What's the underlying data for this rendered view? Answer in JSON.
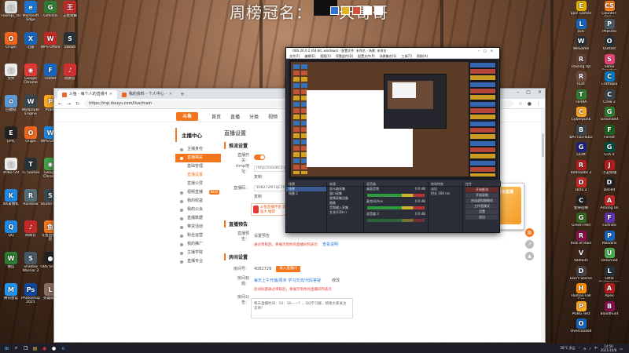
{
  "wallpaper": {
    "title": "周榜冠名：",
    "title_suffix": "天哥哥"
  },
  "desktop_left": [
    {
      "label": "Foxmpi_rar",
      "icon": "file-icon",
      "color": "#dddddd",
      "glyph": "▤"
    },
    {
      "label": "Origin",
      "icon": "origin-icon",
      "color": "#f0661f",
      "glyph": "O"
    },
    {
      "label": "文件",
      "icon": "file-icon",
      "color": "#ececec",
      "glyph": "▤"
    },
    {
      "label": "回收站",
      "icon": "recycle-bin-icon",
      "color": "#5b9bd5",
      "glyph": "♻"
    },
    {
      "label": "EPIC",
      "icon": "epic-icon",
      "color": "#222222",
      "glyph": "E"
    },
    {
      "label": "4082729",
      "icon": "file-icon",
      "color": "#ececec",
      "glyph": "▤"
    },
    {
      "label": "KK录像机",
      "icon": "kk-icon",
      "color": "#1e88e5",
      "glyph": "K"
    },
    {
      "label": "QQ",
      "icon": "qq-icon",
      "color": "#1e88e5",
      "glyph": "Q"
    },
    {
      "label": "微信",
      "icon": "wechat-icon",
      "color": "#2e7d32",
      "glyph": "W"
    },
    {
      "label": "腾讯会议",
      "icon": "meeting-icon",
      "color": "#2196f3",
      "glyph": "M"
    },
    {
      "label": "Microsoft Edge",
      "icon": "edge-icon",
      "color": "#1976d2",
      "glyph": "e"
    },
    {
      "label": "迅雷",
      "icon": "xunlei-icon",
      "color": "#1565c0",
      "glyph": "X"
    },
    {
      "label": "Google Chrome",
      "icon": "chrome-icon",
      "color": "#e53935",
      "glyph": "◉"
    },
    {
      "label": "Wallpaper Engine",
      "icon": "wallpaper-icon",
      "color": "#37474f",
      "glyph": "W"
    },
    {
      "label": "Origin",
      "icon": "origin-icon",
      "color": "#f0661f",
      "glyph": "O"
    },
    {
      "label": "TC Games",
      "icon": "tcgames-icon",
      "color": "#263238",
      "glyph": "T"
    },
    {
      "label": "Rainbow",
      "icon": "rainbow-icon",
      "color": "#546e7a",
      "glyph": "R"
    },
    {
      "label": "网易云",
      "icon": "music-icon",
      "color": "#c62828",
      "glyph": "♪"
    },
    {
      "label": "Shadow Warrior 2",
      "icon": "game-icon",
      "color": "#455a64",
      "glyph": "S"
    },
    {
      "label": "Photoshop 2021",
      "icon": "photoshop-icon",
      "color": "#0d47a1",
      "glyph": "Ps"
    },
    {
      "label": "Geforce",
      "icon": "geforce-icon",
      "color": "#2e7d32",
      "glyph": "G"
    },
    {
      "label": "WPS Office",
      "icon": "wps-icon",
      "color": "#c62828",
      "glyph": "W"
    },
    {
      "label": "Fiddler",
      "icon": "fiddler-icon",
      "color": "#1565c0",
      "glyph": "F"
    },
    {
      "label": "PUBG",
      "icon": "pubg-icon",
      "color": "#f9a825",
      "glyph": "P"
    },
    {
      "label": "WPS Office",
      "icon": "wps-icon",
      "color": "#1e88e5",
      "glyph": "W"
    },
    {
      "label": "Google Chrome",
      "icon": "chrome-icon",
      "color": "#43a047",
      "glyph": "◉"
    },
    {
      "label": "Studio One",
      "icon": "studio-icon",
      "color": "#37474f",
      "glyph": "S"
    },
    {
      "label": "斗鱼直播伴侣",
      "icon": "douyu-icon",
      "color": "#f5751d",
      "glyph": "鱼"
    },
    {
      "label": "OBS Studio",
      "icon": "obs-icon",
      "color": "#212121",
      "glyph": "●"
    },
    {
      "label": "英雄联盟",
      "icon": "lol-icon",
      "color": "#8d6e63",
      "glyph": "L"
    },
    {
      "label": "王者荣耀",
      "icon": "game-icon",
      "color": "#c62828",
      "glyph": "王"
    },
    {
      "label": "Steam",
      "icon": "steam-icon",
      "color": "#263238",
      "glyph": "S"
    },
    {
      "label": "网易云",
      "icon": "music-icon",
      "color": "#d32f2f",
      "glyph": "♪"
    },
    {
      "label": "鸿蒙",
      "icon": "app-icon",
      "color": "#455a64",
      "glyph": "H"
    },
    {
      "label": "Zoom",
      "icon": "zoom-icon",
      "color": "#1565c0",
      "glyph": "Z"
    },
    {
      "label": "腾讯QQ",
      "icon": "qq-icon",
      "color": "#1976d2",
      "glyph": "Q"
    },
    {
      "label": "Deezer",
      "icon": "app-icon",
      "color": "#9c27b0",
      "glyph": "D"
    },
    {
      "label": "Bandicam",
      "icon": "bandicam-icon",
      "color": "#212121",
      "glyph": "B"
    },
    {
      "label": "Welcome",
      "icon": "welcome-icon",
      "color": "#d84315",
      "glyph": "W"
    },
    {
      "label": "火绒安全",
      "icon": "security-icon",
      "color": "#ef6c00",
      "glyph": "火"
    }
  ],
  "desktop_right": [
    {
      "label": "Epic Games",
      "icon": "epic-icon",
      "color": "#e0b100",
      "glyph": "E"
    },
    {
      "label": "LOL",
      "icon": "lol-icon",
      "color": "#1565c0",
      "glyph": "L"
    },
    {
      "label": "WeGame",
      "icon": "wegame-icon",
      "color": "#263238",
      "glyph": "W"
    },
    {
      "label": "Raising Up",
      "icon": "game-icon",
      "color": "#5d4037",
      "glyph": "R"
    },
    {
      "label": "Rust",
      "icon": "rust-icon",
      "color": "#6d4c41",
      "glyph": "R"
    },
    {
      "label": "TERRA",
      "icon": "game-icon",
      "color": "#2e7d32",
      "glyph": "T"
    },
    {
      "label": "Cyberpunk",
      "icon": "game-icon",
      "color": "#f9a825",
      "glyph": "C"
    },
    {
      "label": "BATTLEFIELD",
      "icon": "game-icon",
      "color": "#37474f",
      "glyph": "B"
    },
    {
      "label": "GLIM",
      "icon": "game-icon",
      "color": "#1a237e",
      "glyph": "G"
    },
    {
      "label": "Rednoobs 2",
      "icon": "game-icon",
      "color": "#b71c1c",
      "glyph": "R"
    },
    {
      "label": "Dota 2",
      "icon": "dota-icon",
      "color": "#c62828",
      "glyph": "D"
    },
    {
      "label": "使命召唤",
      "icon": "game-icon",
      "color": "#212121",
      "glyph": "C"
    },
    {
      "label": "Green Hell",
      "icon": "game-icon",
      "color": "#33691e",
      "glyph": "G"
    },
    {
      "label": "Risk of Rain",
      "icon": "game-icon",
      "color": "#880e4f",
      "glyph": "R"
    },
    {
      "label": "Valheim",
      "icon": "game-icon",
      "color": "#3e2723",
      "glyph": "V"
    },
    {
      "label": "Don't Starve",
      "icon": "game-icon",
      "color": "#424242",
      "glyph": "D"
    },
    {
      "label": "Human Fall Flat",
      "icon": "game-icon",
      "color": "#ff8f00",
      "glyph": "H"
    },
    {
      "label": "PUBG Test",
      "icon": "pubg-icon",
      "color": "#f9a825",
      "glyph": "P"
    },
    {
      "label": "Overcooked",
      "icon": "game-icon",
      "color": "#1565c0",
      "glyph": "O"
    },
    {
      "label": "Counter-Strike",
      "icon": "csgo-icon",
      "color": "#f57f17",
      "glyph": "CS"
    },
    {
      "label": "Phasmo",
      "icon": "game-icon",
      "color": "#455a64",
      "glyph": "P"
    },
    {
      "label": "Outlast",
      "icon": "game-icon",
      "color": "#263238",
      "glyph": "O"
    },
    {
      "label": "Slime Rancher",
      "icon": "game-icon",
      "color": "#ec407a",
      "glyph": "S"
    },
    {
      "label": "Craftopia",
      "icon": "game-icon",
      "color": "#0277bd",
      "glyph": "C"
    },
    {
      "label": "Crew 2",
      "icon": "game-icon",
      "color": "#37474f",
      "glyph": "C"
    },
    {
      "label": "Grounded",
      "icon": "game-icon",
      "color": "#2e7d32",
      "glyph": "G"
    },
    {
      "label": "Forest",
      "icon": "game-icon",
      "color": "#1b5e20",
      "glyph": "F"
    },
    {
      "label": "GTA V",
      "icon": "game-icon",
      "color": "#004d40",
      "glyph": "G"
    },
    {
      "label": "小丑惊魂",
      "icon": "game-icon",
      "color": "#b71c1c",
      "glyph": "J"
    },
    {
      "label": "Deceit",
      "icon": "game-icon",
      "color": "#212121",
      "glyph": "D"
    },
    {
      "label": "Among Us",
      "icon": "game-icon",
      "color": "#c62828",
      "glyph": "A"
    },
    {
      "label": "Fortnite",
      "icon": "game-icon",
      "color": "#5e35b1",
      "glyph": "F"
    },
    {
      "label": "Paladins",
      "icon": "game-icon",
      "color": "#1565c0",
      "glyph": "P"
    },
    {
      "label": "Unturned",
      "icon": "game-icon",
      "color": "#4caf50",
      "glyph": "U"
    },
    {
      "label": "Little Nightmares",
      "icon": "game-icon",
      "color": "#263238",
      "glyph": "L"
    },
    {
      "label": "Apex",
      "icon": "game-icon",
      "color": "#b71c1c",
      "glyph": "A"
    },
    {
      "label": "Bloodhunt",
      "icon": "game-icon",
      "color": "#880e4f",
      "glyph": "B"
    }
  ],
  "browser": {
    "tabs": [
      {
        "label": "斗鱼 - 每个人的直播平台"
      },
      {
        "label": "我的资料 - 个人中心 - 斗鱼"
      }
    ],
    "url": "https://mp.douyu.com/live/main",
    "site": {
      "logo": "斗鱼",
      "nav": [
        "首页",
        "直播",
        "分类",
        "视频"
      ]
    },
    "sidebar": {
      "header": "主播中心",
      "items": [
        {
          "label": "主播身份",
          "active": false,
          "sub": false
        },
        {
          "label": "直播相关",
          "active": true,
          "sub": false
        },
        {
          "label": "基础管理",
          "active": false,
          "sub": true
        },
        {
          "label": "直播设置",
          "active": true,
          "sub": true
        },
        {
          "label": "直播公屏",
          "active": false,
          "sub": true
        },
        {
          "label": "视频直播",
          "active": false,
          "sub": false,
          "tag": "NEW"
        },
        {
          "label": "我的收益",
          "active": false,
          "sub": false
        },
        {
          "label": "我的公会",
          "active": false,
          "sub": false
        },
        {
          "label": "直播数据",
          "active": false,
          "sub": false
        },
        {
          "label": "带货活动",
          "active": false,
          "sub": false
        },
        {
          "label": "粉丝运营",
          "active": false,
          "sub": false
        },
        {
          "label": "我的推广",
          "active": false,
          "sub": false
        },
        {
          "label": "主播学院",
          "active": false,
          "sub": false
        },
        {
          "label": "直播专业",
          "active": false,
          "sub": false
        }
      ]
    },
    "main": {
      "title": "直播设置",
      "push_section": "推流设置",
      "push_switch_label": "直播开关：",
      "rtmp_label": "rtmp地址：",
      "rtmp_value": "rtmp://sendtc3.douyu.com/live",
      "copy1": "复制",
      "key_label": "直播码：",
      "key_value": "4082729r1qC7P99N",
      "copy2": "复制",
      "promo": "斗鱼直播伴侣 功能强大 推荐",
      "preview_section": "直播预告",
      "preview_label": "直播预告：",
      "preview_btn": "设置预告",
      "preview_note": "通过审核后，将展示到你的直播间列表页",
      "preview_link": "查看说明",
      "room_section": "房间设置",
      "room_no_label": "房间号：",
      "room_no": "4082729",
      "room_btn": "进入直播间",
      "room_title_label": "房间标题：",
      "room_title": "每天上午开播/周末 学习交流/代码答疑",
      "modify": "修改",
      "room_note": "房间标题通过审核后，将展示到你的直播间列表页",
      "notice_label": "房间公告：",
      "notice_text": "每天直播时间：10：30——？，QQ学习群，感谢大家关注支持！"
    },
    "side_ad": "斗鱼直播伴侣"
  },
  "obs": {
    "title": "OBS 26.0.2 (64-bit, windows) - 配置文件: 未命名 - 场景: 未命名",
    "menu": [
      "文件(F)",
      "编辑(E)",
      "视图(V)",
      "停靠部件(D)",
      "配置文件(P)",
      "场景集合(S)",
      "工具(T)",
      "帮助(H)"
    ],
    "docks": {
      "scenes_title": "场景",
      "scenes": [
        "场景",
        "场景 2"
      ],
      "sources_title": "来源",
      "sources": [
        "显示器采集",
        "窗口采集",
        "视频采集设备",
        "图像",
        "音频输入采集",
        "文本(GDI+)"
      ],
      "mixer_title": "混音器",
      "mixer": [
        {
          "name": "桌面音频",
          "db": "0.0 dB"
        },
        {
          "name": "麦克风/Aux",
          "db": "0.0 dB"
        },
        {
          "name": "混音器 3",
          "db": "0.0 dB"
        }
      ],
      "transitions_title": "转场特效",
      "transition": "淡出",
      "duration_label": "时长",
      "duration": "300 ms",
      "controls_title": "控件",
      "controls": [
        "开始推流",
        "开始录制",
        "启动虚拟摄像机",
        "工作室模式",
        "设置",
        "退出"
      ]
    },
    "float_ad": "斗鱼直播"
  },
  "taskbar": {
    "temp": "28°C 多云",
    "time": "14:50",
    "date": "2021/10/8"
  }
}
